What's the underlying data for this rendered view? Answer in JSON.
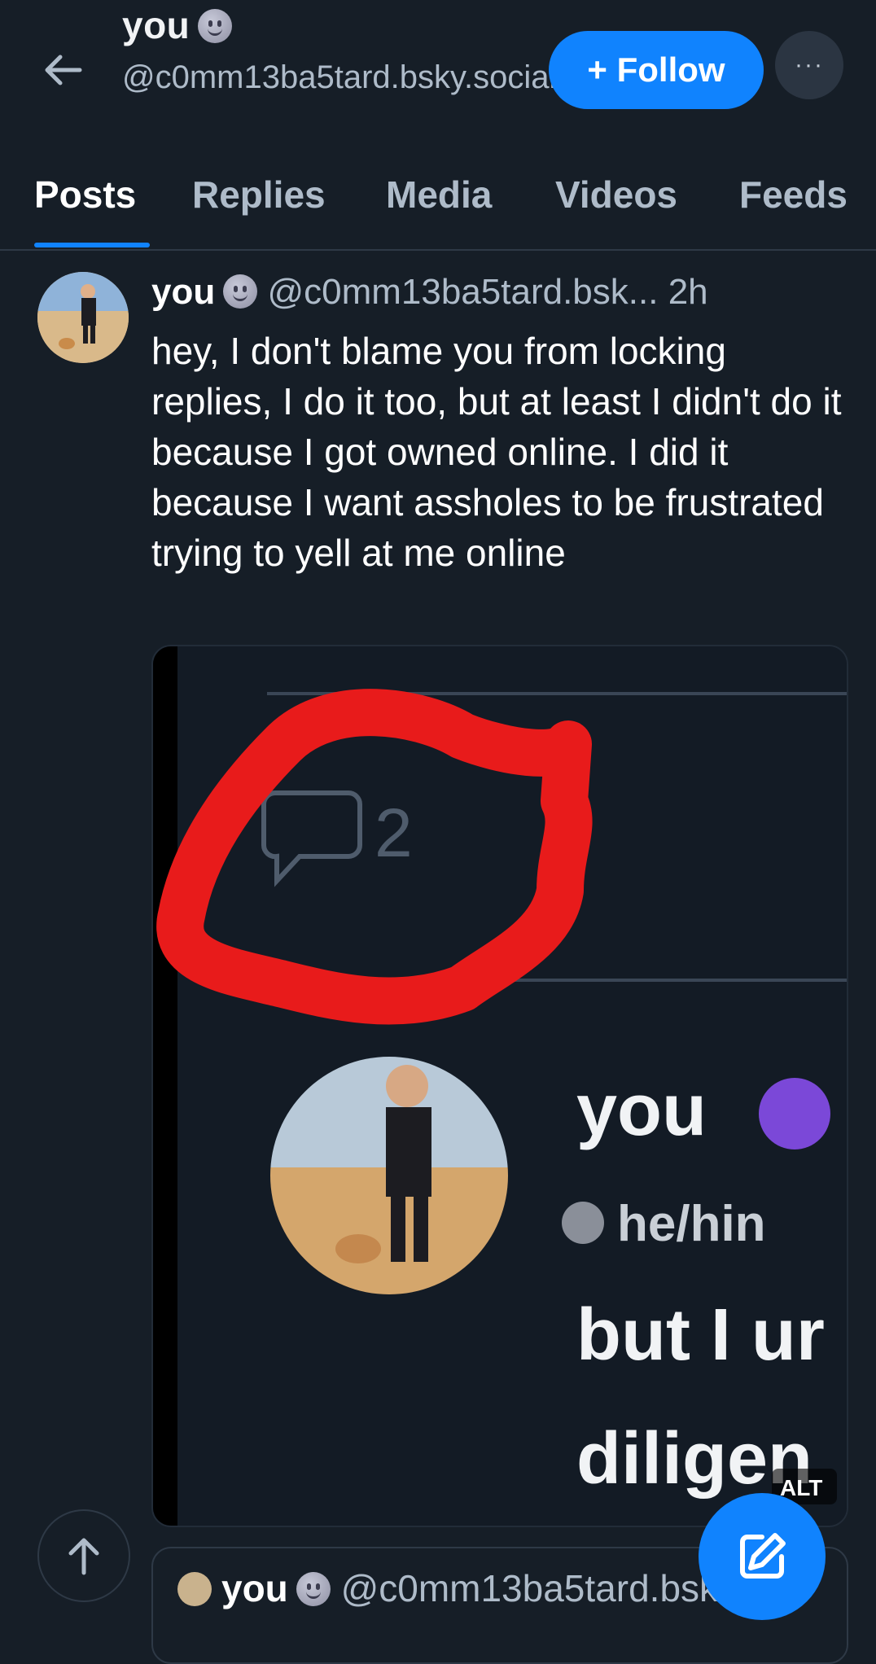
{
  "header": {
    "display_name": "you",
    "handle": "@c0mm13ba5tard.bsky.social",
    "follow_label": "+ Follow",
    "more_label": "···"
  },
  "tabs": [
    {
      "label": "Posts",
      "active": true
    },
    {
      "label": "Replies"
    },
    {
      "label": "Media"
    },
    {
      "label": "Videos"
    },
    {
      "label": "Feeds"
    }
  ],
  "post": {
    "author": "you",
    "handle": "@c0mm13ba5tard.bsk...",
    "time": "2h",
    "text": "hey, I don't blame you from locking replies, I do it too, but at least I didn't do it because I got owned online. I did it because I want assholes to be frustrated trying to yell at me online",
    "embed": {
      "reply_count": "2",
      "name": "you",
      "pronouns": "he/hin",
      "line1": "but I ur",
      "line2": "diligen",
      "alt_badge": "ALT"
    }
  },
  "next_post": {
    "author": "you",
    "handle": "@c0mm13ba5tard.bsk"
  },
  "colors": {
    "background": "#161e27",
    "accent": "#1083fe",
    "muted_text": "#aebbc9",
    "highlight_scribble": "#e81b1b"
  },
  "icons": [
    "back-arrow-icon",
    "more-icon",
    "moon-face-emoji-icon",
    "comment-icon",
    "arrow-up-icon",
    "compose-icon"
  ]
}
